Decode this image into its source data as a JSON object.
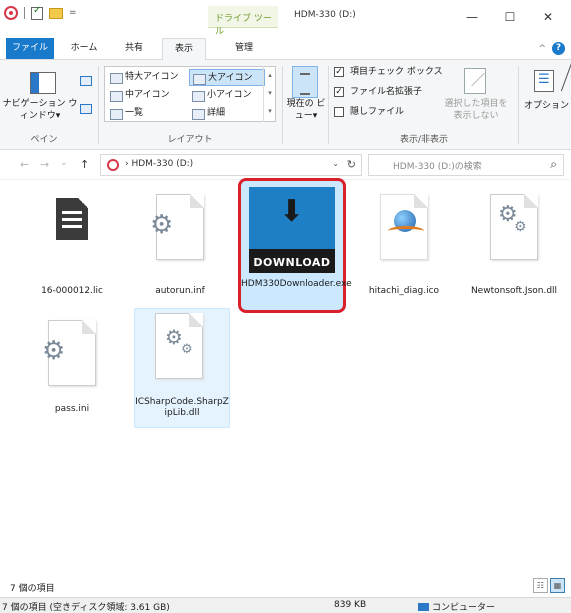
{
  "titlebar": {
    "tool_tab": "ドライブ ツール",
    "title": "HDM-330 (D:)",
    "qa_dropdown": "=",
    "min": "—",
    "max": "☐",
    "close": "✕"
  },
  "tabs": {
    "file": "ファイル",
    "home": "ホーム",
    "share": "共有",
    "view": "表示",
    "manage": "管理",
    "collapse": "^",
    "help": "?"
  },
  "ribbon": {
    "pane": {
      "nav_pane": "ナビゲーション ウィンドウ▾",
      "group": "ペイン"
    },
    "layout": {
      "items": [
        "特大アイコン",
        "大アイコン",
        "中アイコン",
        "小アイコン",
        "一覧",
        "詳細"
      ],
      "selected": "大アイコン",
      "group": "レイアウト"
    },
    "current_view": {
      "label": "現在の ビュー▾"
    },
    "show_hide": {
      "item_checkboxes": "項目チェック ボックス",
      "file_extensions": "ファイル名拡張子",
      "hidden_items": "隠しファイル",
      "item_checkboxes_checked": "✓",
      "file_extensions_checked": "✓",
      "hide_selected": "選択した項目を 表示しない",
      "group": "表示/非表示"
    },
    "options": "オプション"
  },
  "address": {
    "back": "←",
    "forward": "→",
    "recent": "⌄",
    "up": "↑",
    "crumb": "› HDM-330 (D:)",
    "dropdown": "⌄",
    "refresh": "↻",
    "search_placeholder": "HDM-330 (D:)の検索",
    "search_icon": "search-icon"
  },
  "files": [
    {
      "name": "16-000012.lic",
      "icon": "text-document-icon"
    },
    {
      "name": "autorun.inf",
      "icon": "settings-file-icon"
    },
    {
      "name": "HDM330Downloader.exe",
      "icon": "download-app-icon",
      "thumb_text": "DOWNLOAD",
      "highlighted": true
    },
    {
      "name": "hitachi_diag.ico",
      "icon": "globe-icon"
    },
    {
      "name": "Newtonsoft.Json.dll",
      "icon": "settings-file-icon"
    },
    {
      "name": "pass.ini",
      "icon": "settings-file-icon"
    },
    {
      "name": "ICSharpCode.SharpZipLib.dll",
      "icon": "settings-file-icon",
      "selected": true
    }
  ],
  "status": {
    "item_count": "7 個の項目",
    "bottom_left": "7 個の項目 (空きディスク領域: 3.61 GB)",
    "size": "839 KB",
    "location": "コンピューター"
  },
  "colors": {
    "accent": "#1979ca",
    "highlight_border": "#d9202b",
    "tool_tab_text": "#6f9a2c"
  }
}
